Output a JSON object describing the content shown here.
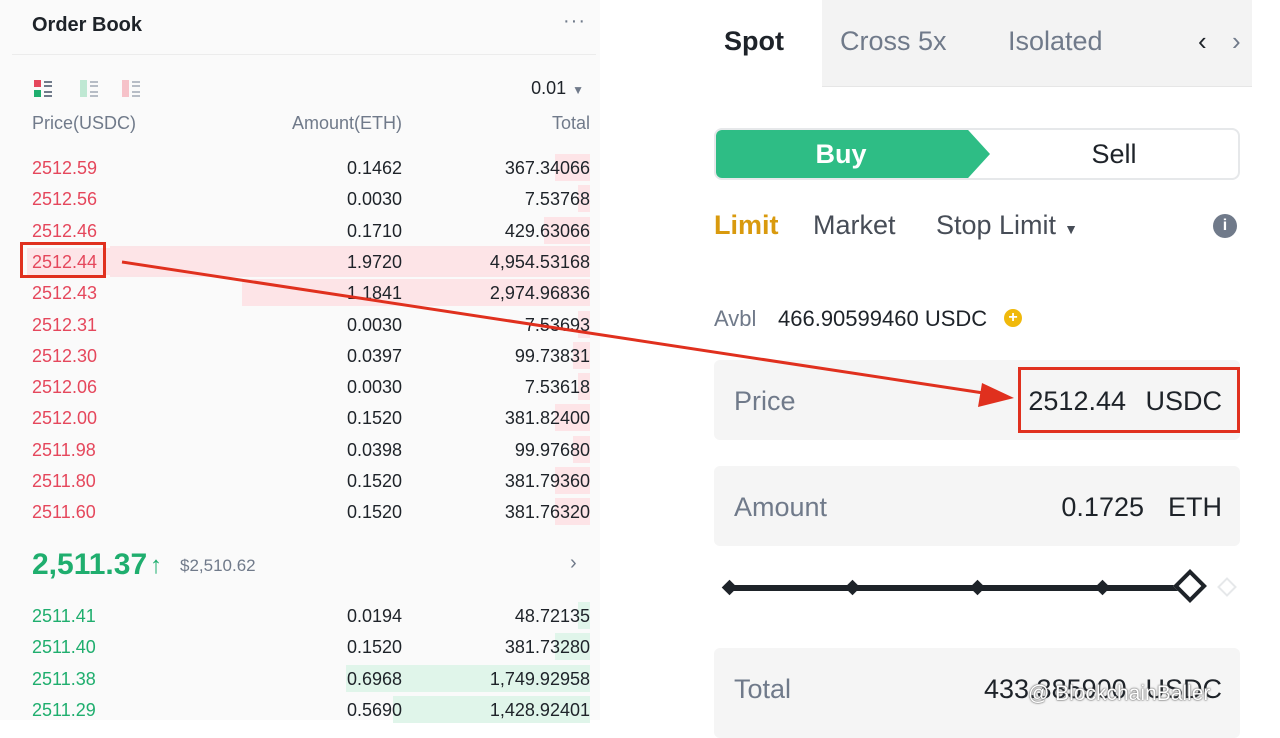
{
  "order_book": {
    "title": "Order Book",
    "more": "···",
    "tick_size": "0.01",
    "columns": {
      "price": "Price(USDC)",
      "amount": "Amount(ETH)",
      "total": "Total"
    },
    "asks": [
      {
        "price": "2512.59",
        "amount": "0.1462",
        "total": "367.34066",
        "depth": 0.06
      },
      {
        "price": "2512.56",
        "amount": "0.0030",
        "total": "7.53768",
        "depth": 0.02
      },
      {
        "price": "2512.46",
        "amount": "0.1710",
        "total": "429.63066",
        "depth": 0.08
      },
      {
        "price": "2512.44",
        "amount": "1.9720",
        "total": "4,954.53168",
        "depth": 0.97
      },
      {
        "price": "2512.43",
        "amount": "1.1841",
        "total": "2,974.96836",
        "depth": 0.6
      },
      {
        "price": "2512.31",
        "amount": "0.0030",
        "total": "7.53693",
        "depth": 0.02
      },
      {
        "price": "2512.30",
        "amount": "0.0397",
        "total": "99.73831",
        "depth": 0.03
      },
      {
        "price": "2512.06",
        "amount": "0.0030",
        "total": "7.53618",
        "depth": 0.02
      },
      {
        "price": "2512.00",
        "amount": "0.1520",
        "total": "381.82400",
        "depth": 0.06
      },
      {
        "price": "2511.98",
        "amount": "0.0398",
        "total": "99.97680",
        "depth": 0.03
      },
      {
        "price": "2511.80",
        "amount": "0.1520",
        "total": "381.79360",
        "depth": 0.06
      },
      {
        "price": "2511.60",
        "amount": "0.1520",
        "total": "381.76320",
        "depth": 0.06
      }
    ],
    "last_price": "2,511.37",
    "last_price_usd": "$2,510.62",
    "bids": [
      {
        "price": "2511.41",
        "amount": "0.0194",
        "total": "48.72135",
        "depth": 0.02
      },
      {
        "price": "2511.40",
        "amount": "0.1520",
        "total": "381.73280",
        "depth": 0.06
      },
      {
        "price": "2511.38",
        "amount": "0.6968",
        "total": "1,749.92958",
        "depth": 0.42
      },
      {
        "price": "2511.29",
        "amount": "0.5690",
        "total": "1,428.92401",
        "depth": 0.34
      }
    ]
  },
  "trade_panel": {
    "tabs": [
      "Spot",
      "Cross 5x",
      "Isolated"
    ],
    "active_tab": "Spot",
    "buy_label": "Buy",
    "sell_label": "Sell",
    "order_types": [
      "Limit",
      "Market",
      "Stop Limit"
    ],
    "active_order_type": "Limit",
    "avbl_label": "Avbl",
    "avbl_value": "466.90599460 USDC",
    "price": {
      "label": "Price",
      "value": "2512.44",
      "unit": "USDC"
    },
    "amount": {
      "label": "Amount",
      "value": "0.1725",
      "unit": "ETH"
    },
    "total": {
      "label": "Total",
      "value": "433.385900",
      "unit": "USDC"
    },
    "slider_level": 1.0
  },
  "watermark": "@ BlockchainBaller",
  "colors": {
    "ask": "#e5475c",
    "bid": "#1fae6e",
    "buy": "#2ebd85",
    "limit_active": "#d99a0e",
    "annotation": "#e0301e"
  }
}
